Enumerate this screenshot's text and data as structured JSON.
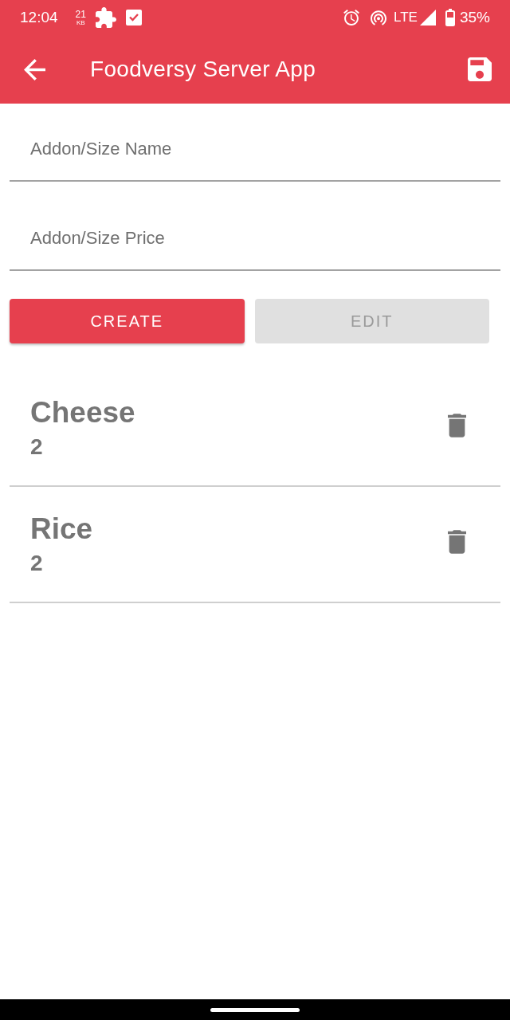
{
  "status_bar": {
    "time": "12:04",
    "data_speed": "21",
    "data_unit": "KB",
    "network": "LTE",
    "battery": "35%"
  },
  "app_bar": {
    "title": "Foodversy Server App"
  },
  "form": {
    "fields": [
      {
        "placeholder": "Addon/Size Name"
      },
      {
        "placeholder": "Addon/Size Price"
      }
    ],
    "buttons": [
      {
        "label": "CREATE",
        "disabled": false
      },
      {
        "label": "EDIT",
        "disabled": true
      }
    ]
  },
  "items": [
    {
      "name": "Cheese",
      "price": "2"
    },
    {
      "name": "Rice",
      "price": "2"
    }
  ]
}
